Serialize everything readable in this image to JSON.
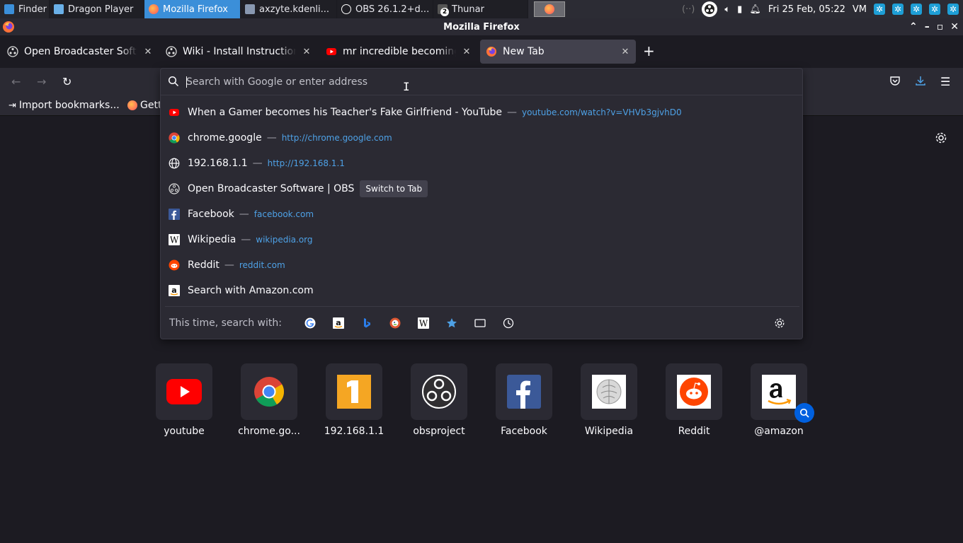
{
  "taskbar": {
    "tasks": [
      {
        "label": "Finder",
        "icon": "finder-icon"
      },
      {
        "label": "Dragon Player",
        "icon": "dragon-player-icon"
      },
      {
        "label": "Mozilla Firefox",
        "icon": "firefox-icon"
      },
      {
        "label": "axzyte.kdenli...",
        "icon": "kdenlive-icon"
      },
      {
        "label": "OBS 26.1.2+d...",
        "icon": "obs-icon"
      },
      {
        "label": "Thunar",
        "icon": "thunar-icon",
        "badge": "2"
      }
    ],
    "clock": "Fri 25 Feb, 05:22",
    "vm": "VM"
  },
  "window": {
    "title": "Mozilla Firefox"
  },
  "tabs": [
    {
      "label": "Open Broadcaster Software | OBS",
      "icon": "obs-icon"
    },
    {
      "label": "Wiki - Install Instructions",
      "icon": "obs-icon"
    },
    {
      "label": "mr incredible becoming uncanny",
      "icon": "youtube-icon"
    },
    {
      "label": "New Tab",
      "icon": "firefox-icon",
      "selected": true
    }
  ],
  "bookmarks": [
    {
      "label": "Import bookmarks...",
      "icon": "import-icon"
    },
    {
      "label": "Getting Started",
      "icon": "firefox-icon"
    }
  ],
  "urlbar": {
    "placeholder": "Search with Google or enter address",
    "value": ""
  },
  "results": [
    {
      "title": "When a Gamer becomes his Teacher's Fake Girlfriend - YouTube",
      "url": "youtube.com/watch?v=VHVb3gjvhD0",
      "icon": "youtube-icon"
    },
    {
      "title": "chrome.google",
      "url": "http://chrome.google.com",
      "icon": "chrome-icon"
    },
    {
      "title": "192.168.1.1",
      "url": "http://192.168.1.1",
      "icon": "globe-icon"
    },
    {
      "title": "Open Broadcaster Software | OBS",
      "action": "Switch to Tab",
      "icon": "obs-icon"
    },
    {
      "title": "Facebook",
      "url": "facebook.com",
      "icon": "facebook-icon"
    },
    {
      "title": "Wikipedia",
      "url": "wikipedia.org",
      "icon": "wikipedia-icon"
    },
    {
      "title": "Reddit",
      "url": "reddit.com",
      "icon": "reddit-icon"
    },
    {
      "title": "Search with Amazon.com",
      "icon": "amazon-icon"
    }
  ],
  "one_off_search": {
    "label": "This time, search with:",
    "engines": [
      "google-icon",
      "amazon-icon",
      "bing-icon",
      "duckduckgo-icon",
      "wikipedia-icon",
      "bookmarks-star-icon",
      "tabs-icon",
      "history-icon"
    ]
  },
  "top_sites": [
    {
      "label": "youtube",
      "icon": "youtube-icon"
    },
    {
      "label": "chrome.go...",
      "icon": "chrome-icon"
    },
    {
      "label": "192.168.1.1",
      "icon": "number-one-icon"
    },
    {
      "label": "obsproject",
      "icon": "obs-icon"
    },
    {
      "label": "Facebook",
      "icon": "facebook-icon"
    },
    {
      "label": "Wikipedia",
      "icon": "wikipedia-icon"
    },
    {
      "label": "Reddit",
      "icon": "reddit-icon"
    },
    {
      "label": "@amazon",
      "icon": "amazon-icon"
    }
  ],
  "colors": {
    "accent": "#3b8fd9",
    "url_link": "#4ea1e6",
    "panel_bg": "#2b2a33",
    "page_bg": "#1c1b22"
  }
}
